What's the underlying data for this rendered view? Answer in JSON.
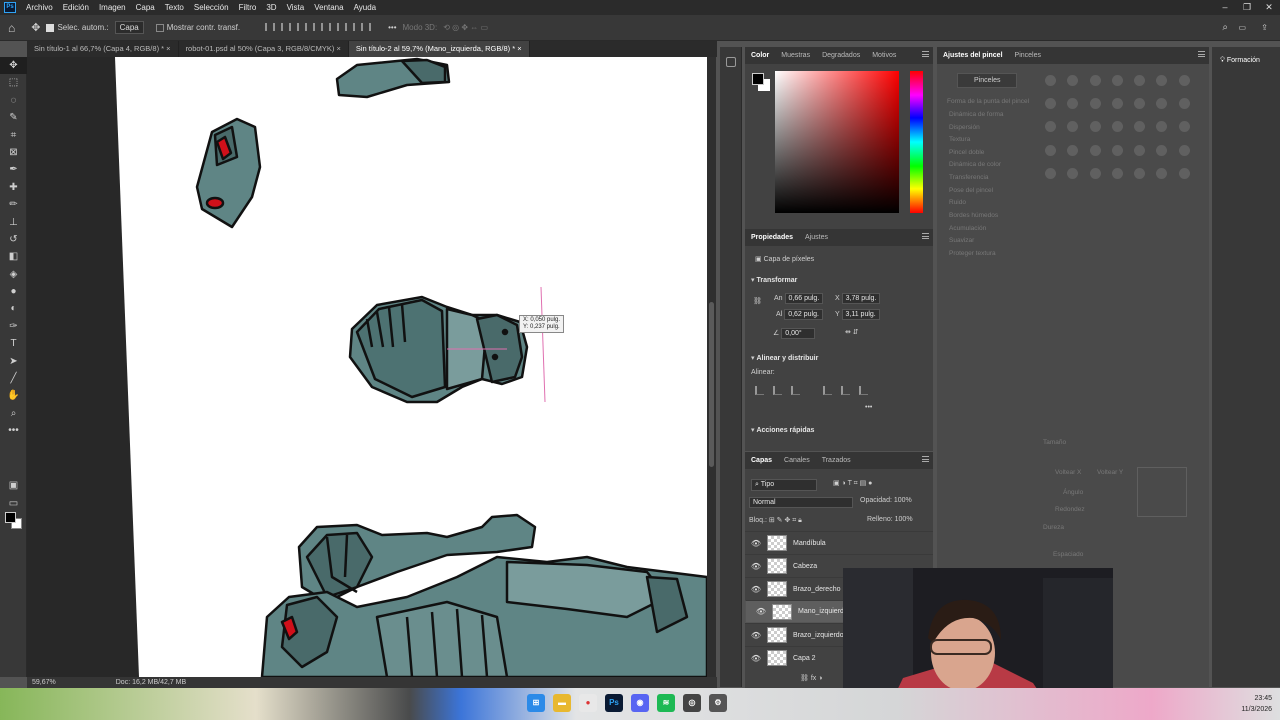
{
  "app": {
    "logo": "Ps"
  },
  "menu": [
    "Archivo",
    "Edición",
    "Imagen",
    "Capa",
    "Texto",
    "Selección",
    "Filtro",
    "3D",
    "Vista",
    "Ventana",
    "Ayuda"
  ],
  "options": {
    "auto_select_label": "Selec. autom.:",
    "auto_select_value": "Capa",
    "show_transform_label": "Mostrar contr. transf.",
    "mode_3d": "Modo 3D:"
  },
  "tabs": [
    "Sin título-1 al 66,7% (Capa 4, RGB/8) *",
    "robot-01.psd al 50% (Capa 3, RGB/8/CMYK)",
    "Sin título-2 al 59,7% (Mano_izquierda, RGB/8) *"
  ],
  "status": {
    "zoom": "59,67%",
    "doc": "Doc: 16,2 MB/42,7 MB"
  },
  "tooltip": {
    "x": "X: 0,050 pulg.",
    "y": "Y: 0,237 pulg."
  },
  "color_panel": {
    "tabs": [
      "Color",
      "Muestras",
      "Degradados",
      "Motivos"
    ],
    "fg": "#000000",
    "bg": "#ffffff",
    "hue": "#ff0000"
  },
  "properties": {
    "tabs": [
      "Propiedades",
      "Ajustes"
    ],
    "layer_type": "Capa de píxeles",
    "transform_title": "Transformar",
    "w_label": "An",
    "w": "0,66 pulg.",
    "x_label": "X",
    "x": "3,78 pulg.",
    "h_label": "Al",
    "h": "0,62 pulg.",
    "y_label": "Y",
    "y": "3,11 pulg.",
    "angle": "0,00°",
    "align_title": "Alinear y distribuir",
    "align_label": "Alinear:",
    "quick_title": "Acciones rápidas"
  },
  "layers": {
    "tabs": [
      "Capas",
      "Canales",
      "Trazados"
    ],
    "filter": "Tipo",
    "blend": "Normal",
    "opacity_label": "Opacidad:",
    "opacity": "100%",
    "lock_label": "Bloq.:",
    "fill_label": "Relleno:",
    "fill": "100%",
    "items": [
      {
        "name": "Mandíbula"
      },
      {
        "name": "Cabeza"
      },
      {
        "name": "Brazo_derecho"
      },
      {
        "name": "Mano_izquierda"
      },
      {
        "name": "Brazo_izquierdo"
      },
      {
        "name": "Capa 2"
      }
    ]
  },
  "brush_panel": {
    "tabs": [
      "Ajustes del pincel",
      "Pinceles"
    ],
    "button": "Pinceles",
    "heading": "Forma de la punta del pincel",
    "options": [
      "Dinámica de forma",
      "Dispersión",
      "Textura",
      "Pincel doble",
      "Dinámica de color",
      "Transferencia",
      "Pose del pincel",
      "Ruido",
      "Bordes húmedos",
      "Acumulación",
      "Suavizar",
      "Proteger textura"
    ],
    "size_label": "Tamaño",
    "flip_x": "Voltear X",
    "flip_y": "Voltear Y",
    "angle_label": "Ángulo",
    "round_label": "Redondez",
    "hardness_label": "Dureza",
    "spacing_label": "Espaciado"
  },
  "learn": {
    "label": "Formación"
  },
  "clock": {
    "time": "23:45",
    "date": "11/3/2026"
  }
}
